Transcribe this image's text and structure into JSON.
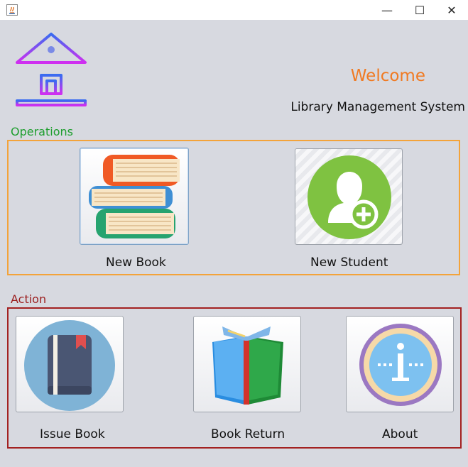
{
  "window": {
    "minimize_glyph": "—",
    "maximize_glyph": "☐",
    "close_glyph": "✕"
  },
  "header": {
    "welcome": "Welcome",
    "system_title": "Library Management System"
  },
  "operations": {
    "label": "Operations",
    "new_book": "New Book",
    "new_student": "New Student"
  },
  "action": {
    "label": "Action",
    "issue_book": "Issue Book",
    "book_return": "Book Return",
    "about": "About"
  },
  "colors": {
    "welcome": "#f07a22",
    "operations_border": "#f3a33a",
    "action_border": "#a32121",
    "operations_label": "#1e9e2e",
    "action_label": "#9b1d1d"
  },
  "icons": [
    "java-app-icon",
    "library-building-icon",
    "book-stack-icon",
    "add-user-icon",
    "notebook-icon",
    "open-book-icon",
    "info-icon"
  ]
}
